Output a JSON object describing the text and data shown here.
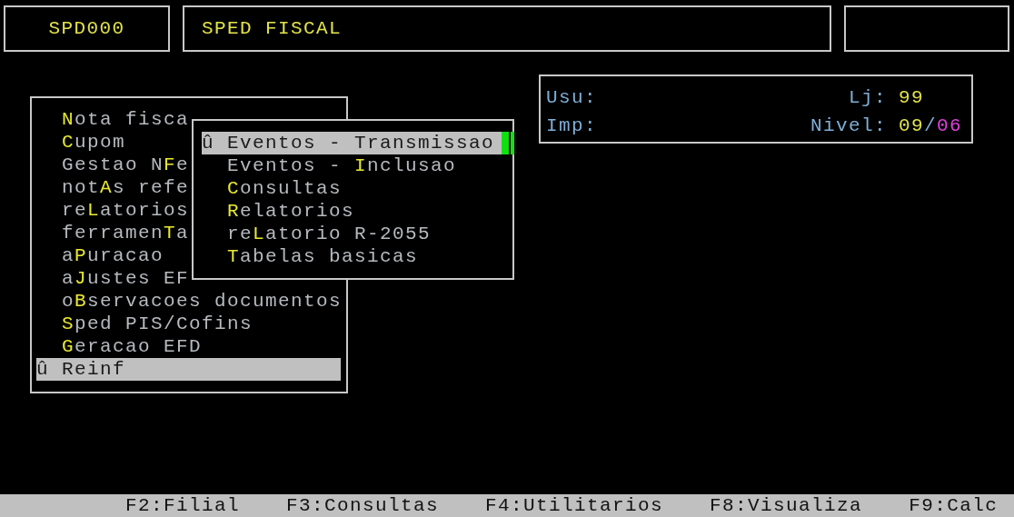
{
  "header": {
    "program_code": "SPD000",
    "title": "SPED FISCAL"
  },
  "info": {
    "user_label": "Usu:",
    "printer_label": "Imp:",
    "store_label": "Lj:",
    "store_value": "99",
    "level_label": "Nivel:",
    "level_user": "09",
    "level_separator": "/",
    "level_max": "06"
  },
  "main_menu": {
    "focused": false,
    "items": [
      {
        "label": "**N**ota fisca",
        "selected": false
      },
      {
        "label": "**C**upom",
        "selected": false
      },
      {
        "label": "Gestao N**F**e",
        "selected": false
      },
      {
        "label": "not**A**s refe",
        "selected": false
      },
      {
        "label": "re**L**atorios",
        "selected": false
      },
      {
        "label": "ferramen**T**a",
        "selected": false
      },
      {
        "label": "a**P**uracao",
        "selected": false
      },
      {
        "label": "a**J**ustes EF",
        "selected": false
      },
      {
        "label": "o**B**servacoes documentos",
        "selected": false
      },
      {
        "label": "**S**ped PIS/Cofins",
        "selected": false
      },
      {
        "label": "**G**eracao EFD",
        "selected": false
      },
      {
        "label": "û Reinf",
        "selected": true
      }
    ]
  },
  "submenu": {
    "focused": true,
    "items": [
      {
        "label": "û Eventos - Transmissao",
        "selected": true
      },
      {
        "label": "Eventos - **I**nclusao",
        "selected": false
      },
      {
        "label": "**C**onsultas",
        "selected": false
      },
      {
        "label": "**R**elatorios",
        "selected": false
      },
      {
        "label": "re**L**atorio R-2055",
        "selected": false
      },
      {
        "label": "**T**abelas basicas",
        "selected": false
      }
    ]
  },
  "function_keys": [
    "F2:Filial",
    "F3:Consultas",
    "F4:Utilitarios",
    "F8:Visualiza",
    "F9:Calc"
  ]
}
